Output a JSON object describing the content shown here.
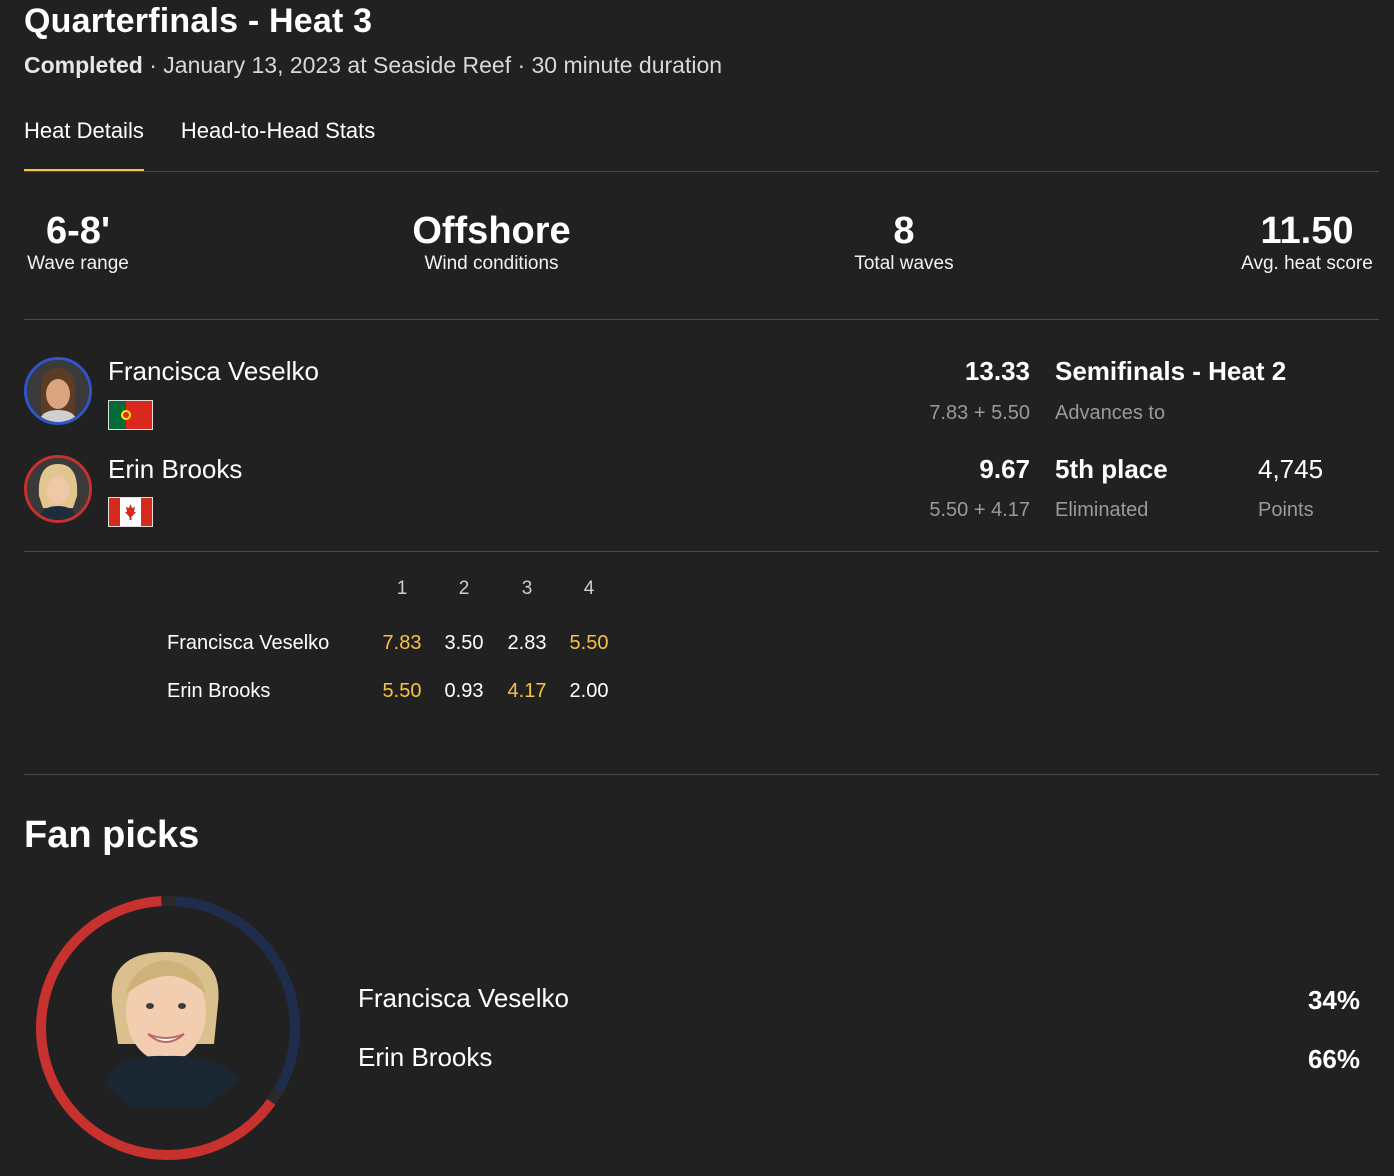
{
  "header": {
    "title": "Quarterfinals - Heat 3",
    "status": "Completed",
    "details": " · January 13, 2023 at Seaside Reef · 30 minute duration"
  },
  "tabs": [
    {
      "label": "Heat Details",
      "active": true
    },
    {
      "label": "Head-to-Head Stats",
      "active": false
    }
  ],
  "stats": [
    {
      "value": "6-8'",
      "label": "Wave range"
    },
    {
      "value": "Offshore",
      "label": "Wind conditions"
    },
    {
      "value": "8",
      "label": "Total waves"
    },
    {
      "value": "11.50",
      "label": "Avg. heat score"
    }
  ],
  "athletes": [
    {
      "name": "Francisca Veselko",
      "country_flag": "portugal-flag",
      "ring_color": "#2f56c6",
      "score": "13.33",
      "breakdown": "7.83 + 5.50",
      "result": "Semifinals - Heat 2",
      "result_sub": "Advances to",
      "points": "",
      "points_label": ""
    },
    {
      "name": "Erin Brooks",
      "country_flag": "canada-flag",
      "ring_color": "#c7322f",
      "score": "9.67",
      "breakdown": "5.50 + 4.17",
      "result": "5th place",
      "result_sub": "Eliminated",
      "points": "4,745",
      "points_label": "Points"
    }
  ],
  "waves": {
    "headers": [
      "1",
      "2",
      "3",
      "4"
    ],
    "rows": [
      {
        "name": "Francisca Veselko",
        "scores": [
          "7.83",
          "3.50",
          "2.83",
          "5.50"
        ],
        "highlight": [
          true,
          false,
          false,
          true
        ]
      },
      {
        "name": "Erin Brooks",
        "scores": [
          "5.50",
          "0.93",
          "4.17",
          "2.00"
        ],
        "highlight": [
          true,
          false,
          true,
          false
        ]
      }
    ],
    "highlight_color": "#f6c343"
  },
  "fan_picks": {
    "title": "Fan picks",
    "picks": [
      {
        "name": "Francisca Veselko",
        "percent": "34%",
        "fraction": 0.34,
        "color": "#1f2d4d"
      },
      {
        "name": "Erin Brooks",
        "percent": "66%",
        "fraction": 0.66,
        "color": "#c7322f"
      }
    ]
  },
  "colors": {
    "background": "#212121",
    "accent": "#f6c343",
    "divider": "#4a4a4a"
  }
}
